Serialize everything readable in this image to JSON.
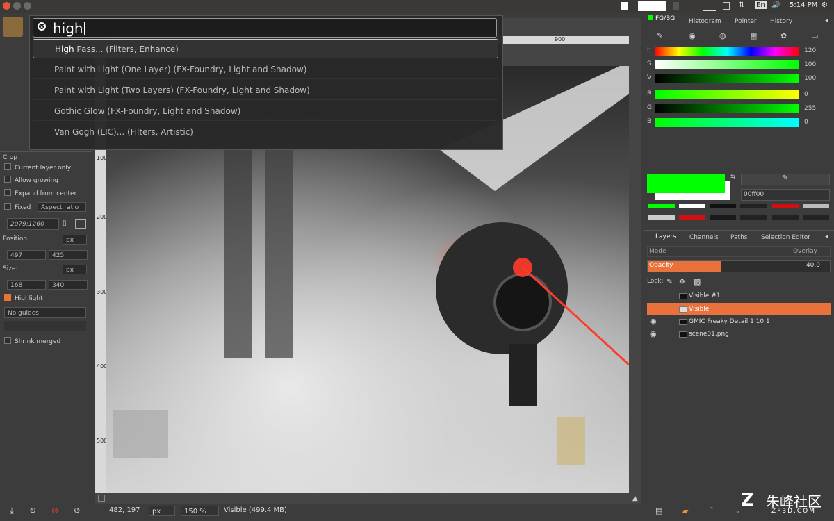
{
  "system_bar": {
    "time": "5:14 PM",
    "keyboard_layout": "En",
    "volume_icon": "speaker-icon"
  },
  "search_popup": {
    "query": "high",
    "results": [
      {
        "match": "High",
        "rest": " Pass... (Filters, Enhance)"
      },
      {
        "match": "",
        "rest": "Paint with Light (One Layer) (FX-Foundry, Light and Shadow)"
      },
      {
        "match": "",
        "rest": "Paint with Light (Two Layers) (FX-Foundry, Light and Shadow)"
      },
      {
        "match": "",
        "rest": "Gothic Glow (FX-Foundry, Light and Shadow)"
      },
      {
        "match": "",
        "rest": "Van Gogh (LIC)... (Filters, Artistic)"
      }
    ]
  },
  "tool_options": {
    "tool_name": "Crop",
    "current_layer_only": "Current layer only",
    "allow_growing": "Allow growing",
    "expand_from_center": "Expand from center",
    "fixed": "Fixed",
    "aspect_ratio": "Aspect ratio",
    "ratio_value": "2079:1260",
    "position_label": "Position:",
    "position_unit": "px",
    "position_x": "497",
    "position_y": "425",
    "size_label": "Size:",
    "size_unit": "px",
    "size_w": "168",
    "size_h": "340",
    "highlight": "Highlight",
    "guides": "No guides",
    "shrink_merged": "Shrink merged"
  },
  "rulers": {
    "h_tick": "900",
    "v_ticks": [
      "100",
      "200",
      "300",
      "400",
      "500"
    ]
  },
  "status_bar": {
    "coords": "482, 197",
    "unit": "px",
    "zoom": "150 %",
    "info": "Visible (499.4 MB)"
  },
  "color_dock": {
    "tabs": [
      "FG/BG",
      "Histogram",
      "Pointer",
      "History"
    ],
    "sliders": [
      {
        "name": "H",
        "value": "120"
      },
      {
        "name": "S",
        "value": "100"
      },
      {
        "name": "V",
        "value": "100"
      },
      {
        "name": "R",
        "value": "0"
      },
      {
        "name": "G",
        "value": "255"
      },
      {
        "name": "B",
        "value": "0"
      }
    ],
    "hex": "00ff00",
    "fg_color": "#00ff00",
    "bg_color": "#ffffff"
  },
  "layers_dock": {
    "tabs": [
      "Layers",
      "Channels",
      "Paths",
      "Selection Editor"
    ],
    "mode_label": "Mode",
    "mode_value": "Overlay",
    "opacity_label": "Opacity",
    "opacity_value": "40.0",
    "opacity_fraction": 0.4,
    "lock_label": "Lock:",
    "layers": [
      {
        "name": "Visible #1",
        "visible": false
      },
      {
        "name": "Visible",
        "visible": false,
        "active": true
      },
      {
        "name": "GMIC Freaky Detail 1 10 1",
        "visible": true
      },
      {
        "name": "scene01.png",
        "visible": true
      }
    ]
  },
  "watermark": {
    "text": "朱峰社区",
    "site": "ZF3D.COM"
  }
}
